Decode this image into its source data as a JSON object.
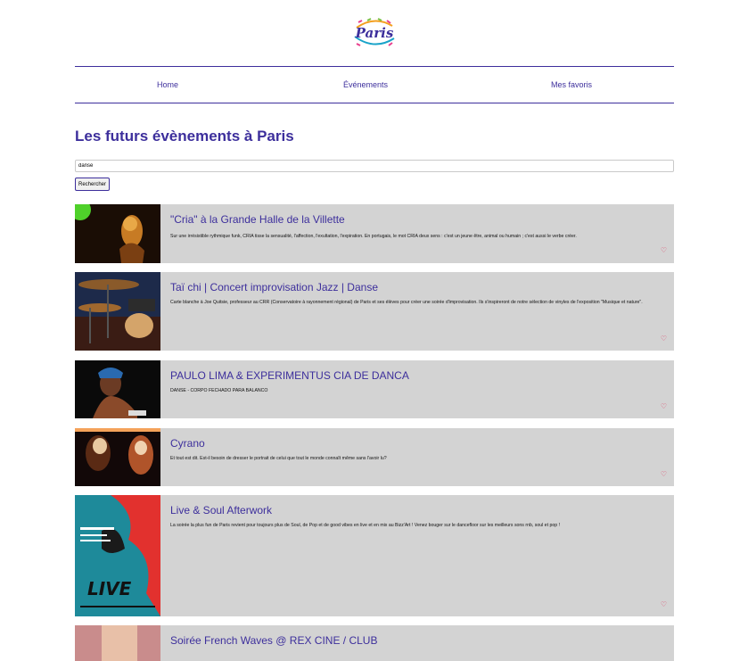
{
  "logo": {
    "text": "Paris",
    "icon": "paris-logo"
  },
  "nav": {
    "items": [
      {
        "label": "Home"
      },
      {
        "label": "Événements"
      },
      {
        "label": "Mes favoris"
      }
    ]
  },
  "page": {
    "title": "Les futurs évènements à Paris"
  },
  "search": {
    "value": "danse",
    "button_label": "Rechercher"
  },
  "colors": {
    "accent": "#3d2f9c",
    "card_bg": "#d3d3d3",
    "heart": "#e0466b"
  },
  "events": [
    {
      "title": "\"Cria\" à la Grande Halle de la Villette",
      "description": "Sur une irrésistible rythmique funk, CRIA tisse la sensualité, l'affection, l'exultation, l'expiration. En portugais, le mot CRIA deux sens : c'est un jeune être, animal ou humain ; c'est aussi le verbe créer.",
      "favorite_icon": "heart-outline-icon"
    },
    {
      "title": "Taï chi | Concert improvisation Jazz | Danse",
      "description": "Carte blanche à Joe Quitsie, professeur au CRR (Conservatoire à rayonnement régional) de Paris et ses élèves pour créer une soirée d'improvisation. Ils s'inspireront de notre sélection de vinyles de l'exposition \"Musique et nature\".",
      "favorite_icon": "heart-outline-icon"
    },
    {
      "title": "PAULO LIMA & EXPERIMENTUS CIA DE DANCA",
      "description": "DANSE - CORPO FECHADO PARA BALANCO",
      "favorite_icon": "heart-outline-icon"
    },
    {
      "title": "Cyrano",
      "description": "Et tout est dit. Est-il besoin de dresser le portrait de celui que tout le monde connaît même sans l'avoir lu?",
      "favorite_icon": "heart-outline-icon"
    },
    {
      "title": "Live & Soul Afterwork",
      "description": "La soirée la plus fun de Paris revient pour toujours plus de Soul, de Pop et de good vibes en live et en mix au Bizz'Art ! Venez bouger sur le dancefloor sur les meilleurs sons rnb, soul et pop !",
      "favorite_icon": "heart-outline-icon"
    },
    {
      "title": "Soirée French Waves @ REX CINE / CLUB",
      "description": "",
      "favorite_icon": "heart-outline-icon"
    }
  ]
}
